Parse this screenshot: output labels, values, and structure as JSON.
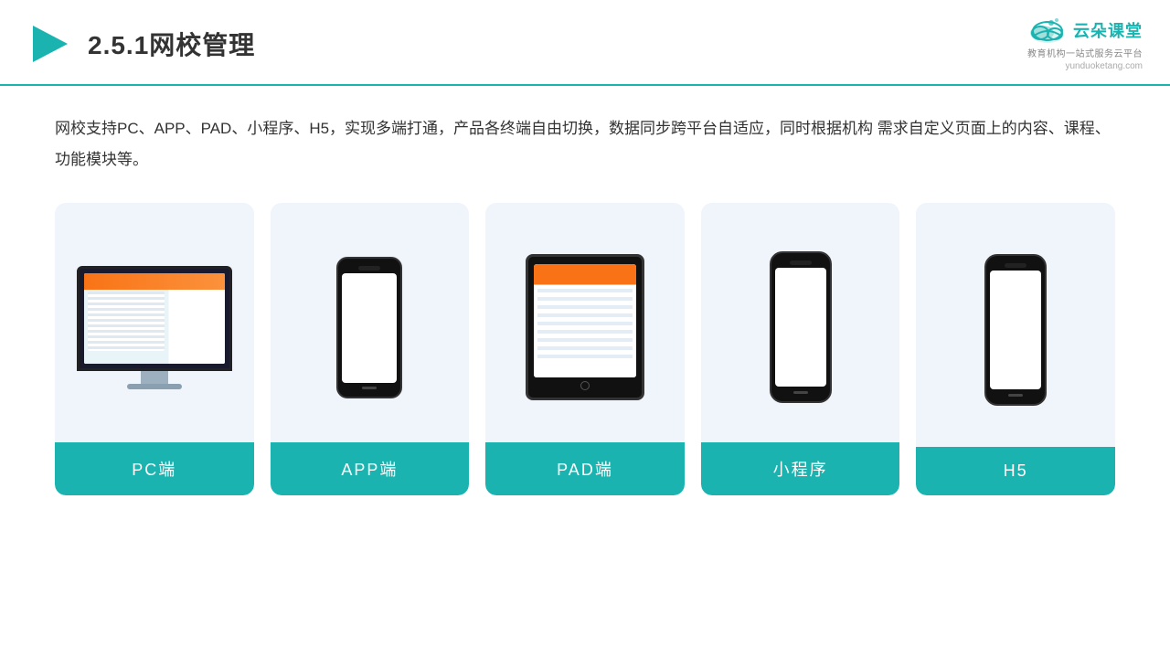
{
  "header": {
    "title": "2.5.1网校管理",
    "logo_name": "云朵课堂",
    "logo_url": "yunduoketang.com",
    "logo_tagline": "教育机构一站\n式服务云平台"
  },
  "description": "网校支持PC、APP、PAD、小程序、H5，实现多端打通，产品各终端自由切换，数据同步跨平台自适应，同时根据机构\n需求自定义页面上的内容、课程、功能模块等。",
  "cards": [
    {
      "id": "pc",
      "label": "PC端"
    },
    {
      "id": "app",
      "label": "APP端"
    },
    {
      "id": "pad",
      "label": "PAD端"
    },
    {
      "id": "miniprogram",
      "label": "小程序"
    },
    {
      "id": "h5",
      "label": "H5"
    }
  ],
  "accent_color": "#1ab3b0"
}
